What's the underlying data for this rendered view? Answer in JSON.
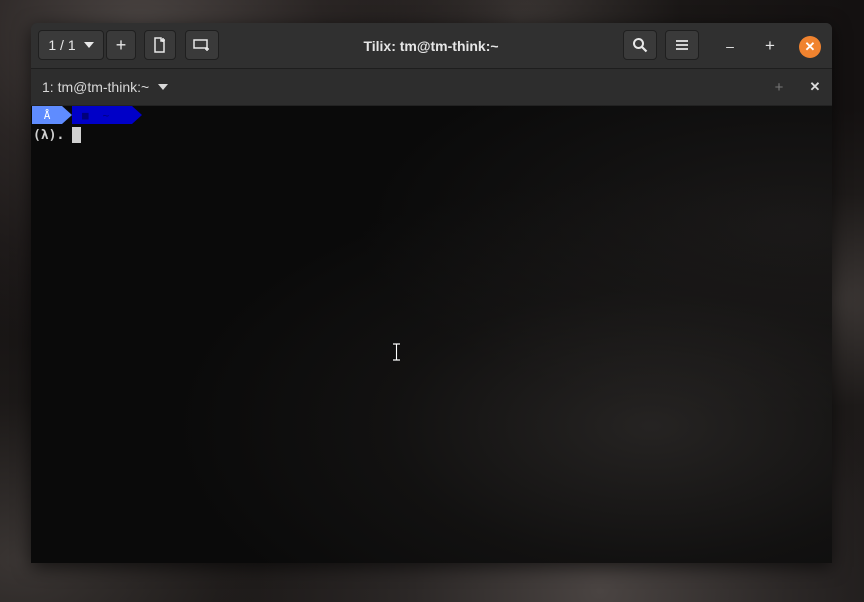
{
  "header": {
    "session_switcher_label": "1 / 1",
    "title": "Tilix: tm@tm-think:~",
    "buttons": {
      "add_session": "+",
      "minimize": "–",
      "maximize": "+",
      "close": "✕"
    }
  },
  "tabbar": {
    "session_label": "1: tm@tm-think:~",
    "add_label": "+",
    "close_label": "✕"
  },
  "terminal": {
    "powerline": [
      {
        "text": "Å",
        "bg": "#5f8cff"
      },
      {
        "text": "■",
        "bg": "#0000c8"
      },
      {
        "text": "~",
        "bg": "#0000c8"
      }
    ],
    "prompt": "(λ)."
  },
  "colors": {
    "accent_close": "#f0832f",
    "powerline_light_blue": "#5f8cff",
    "powerline_blue": "#0000c8"
  }
}
